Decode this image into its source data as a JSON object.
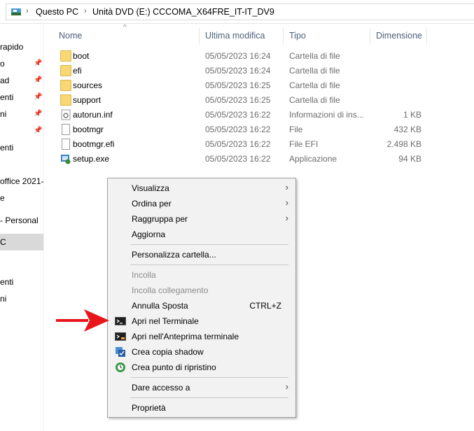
{
  "breadcrumb": {
    "items": [
      "Questo PC",
      "Unità DVD (E:) CCCOMA_X64FRE_IT-IT_DV9"
    ]
  },
  "nav": {
    "items": [
      {
        "label": "rapido",
        "pinned": false
      },
      {
        "label": "o",
        "pinned": true
      },
      {
        "label": "ad",
        "pinned": true
      },
      {
        "label": "enti",
        "pinned": true
      },
      {
        "label": "ni",
        "pinned": true
      },
      {
        "label": "",
        "pinned": true
      },
      {
        "label": "enti",
        "pinned": false
      },
      {
        "label": "office 2021-",
        "pinned": false
      },
      {
        "label": "e",
        "pinned": false
      },
      {
        "label": "- Personal",
        "pinned": false
      },
      {
        "label": "C",
        "pinned": false,
        "selected": true
      },
      {
        "label": "enti",
        "pinned": false
      },
      {
        "label": "ni",
        "pinned": false
      }
    ]
  },
  "columns": {
    "name": "Nome",
    "modified": "Ultima modifica",
    "type": "Tipo",
    "size": "Dimensione"
  },
  "files": [
    {
      "name": "boot",
      "date": "05/05/2023 16:24",
      "type": "Cartella di file",
      "size": "",
      "icon": "folder-icon"
    },
    {
      "name": "efi",
      "date": "05/05/2023 16:24",
      "type": "Cartella di file",
      "size": "",
      "icon": "folder-icon"
    },
    {
      "name": "sources",
      "date": "05/05/2023 16:25",
      "type": "Cartella di file",
      "size": "",
      "icon": "folder-icon"
    },
    {
      "name": "support",
      "date": "05/05/2023 16:25",
      "type": "Cartella di file",
      "size": "",
      "icon": "folder-icon"
    },
    {
      "name": "autorun.inf",
      "date": "05/05/2023 16:22",
      "type": "Informazioni di ins...",
      "size": "1 KB",
      "icon": "settings-file-icon"
    },
    {
      "name": "bootmgr",
      "date": "05/05/2023 16:22",
      "type": "File",
      "size": "432 KB",
      "icon": "file-icon"
    },
    {
      "name": "bootmgr.efi",
      "date": "05/05/2023 16:22",
      "type": "File EFI",
      "size": "2.498 KB",
      "icon": "file-icon"
    },
    {
      "name": "setup.exe",
      "date": "05/05/2023 16:22",
      "type": "Applicazione",
      "size": "94 KB",
      "icon": "setup-icon"
    }
  ],
  "context_menu": {
    "view": "Visualizza",
    "sort_by": "Ordina per",
    "group_by": "Raggruppa per",
    "refresh": "Aggiorna",
    "customize": "Personalizza cartella...",
    "paste": "Incolla",
    "paste_link": "Incolla collegamento",
    "undo_move": "Annulla Sposta",
    "undo_shortcut": "CTRL+Z",
    "open_terminal": "Apri nel Terminale",
    "open_terminal_preview": "Apri nell'Anteprima terminale",
    "shadow_copy": "Crea copia shadow",
    "restore_point": "Crea punto di ripristino",
    "give_access": "Dare accesso a",
    "properties": "Proprietà"
  },
  "colors": {
    "accent_arrow": "#e8161b",
    "folder": "#f8d775",
    "header_text": "#4c607a",
    "menu_bg": "#f2f2f2"
  }
}
